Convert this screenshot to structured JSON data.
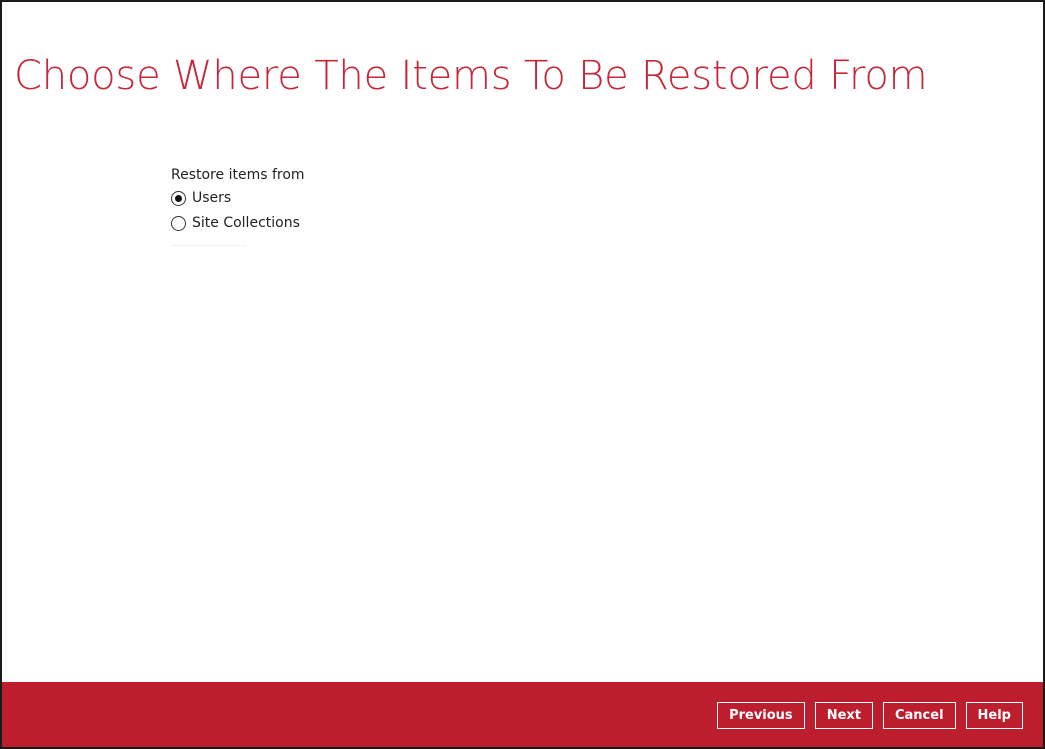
{
  "page": {
    "title": "Choose Where The Items To Be Restored From"
  },
  "restore_source": {
    "label": "Restore items from",
    "options": [
      {
        "label": "Users",
        "selected": true
      },
      {
        "label": "Site Collections",
        "selected": false
      }
    ]
  },
  "footer": {
    "previous_label": "Previous",
    "next_label": "Next",
    "cancel_label": "Cancel",
    "help_label": "Help"
  },
  "colors": {
    "accent": "#bd1e2d",
    "title": "#c4293a"
  }
}
